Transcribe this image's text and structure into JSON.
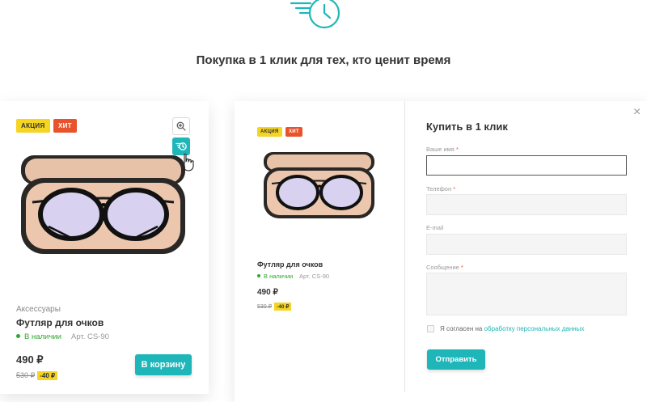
{
  "header": {
    "title": "Покупка в 1 клик для тех, кто ценит время"
  },
  "card": {
    "badges": {
      "sale": "АКЦИЯ",
      "hit": "ХИТ"
    },
    "category": "Аксессуары",
    "name": "Футляр для очков",
    "stock": "В наличии",
    "article": "Арт. CS-90",
    "price": "490 ₽",
    "old_price": "530 ₽",
    "discount": "-40 ₽",
    "cart_button": "В корзину"
  },
  "modal": {
    "product": {
      "badges": {
        "sale": "АКЦИЯ",
        "hit": "ХИТ"
      },
      "name": "Футляр для очков",
      "stock": "В наличии",
      "article": "Арт. CS-90",
      "price": "490 ₽",
      "old_price": "530 ₽",
      "discount": "-40 ₽"
    },
    "title": "Купить в 1 клик",
    "fields": {
      "name_label": "Ваше имя",
      "phone_label": "Телефон",
      "email_label": "E-mail",
      "message_label": "Сообщение",
      "required_mark": "*"
    },
    "consent": {
      "text": "Я согласен на",
      "link": "обработку персональных данных"
    },
    "submit": "Отправить",
    "close": "×"
  },
  "colors": {
    "accent": "#1fb6b9",
    "sale_badge": "#f5d422",
    "hit_badge": "#e8532c",
    "in_stock": "#2ea72e"
  },
  "icons": [
    "fast-clock-icon",
    "zoom-icon",
    "quick-buy-icon",
    "hand-cursor-icon",
    "close-icon"
  ]
}
